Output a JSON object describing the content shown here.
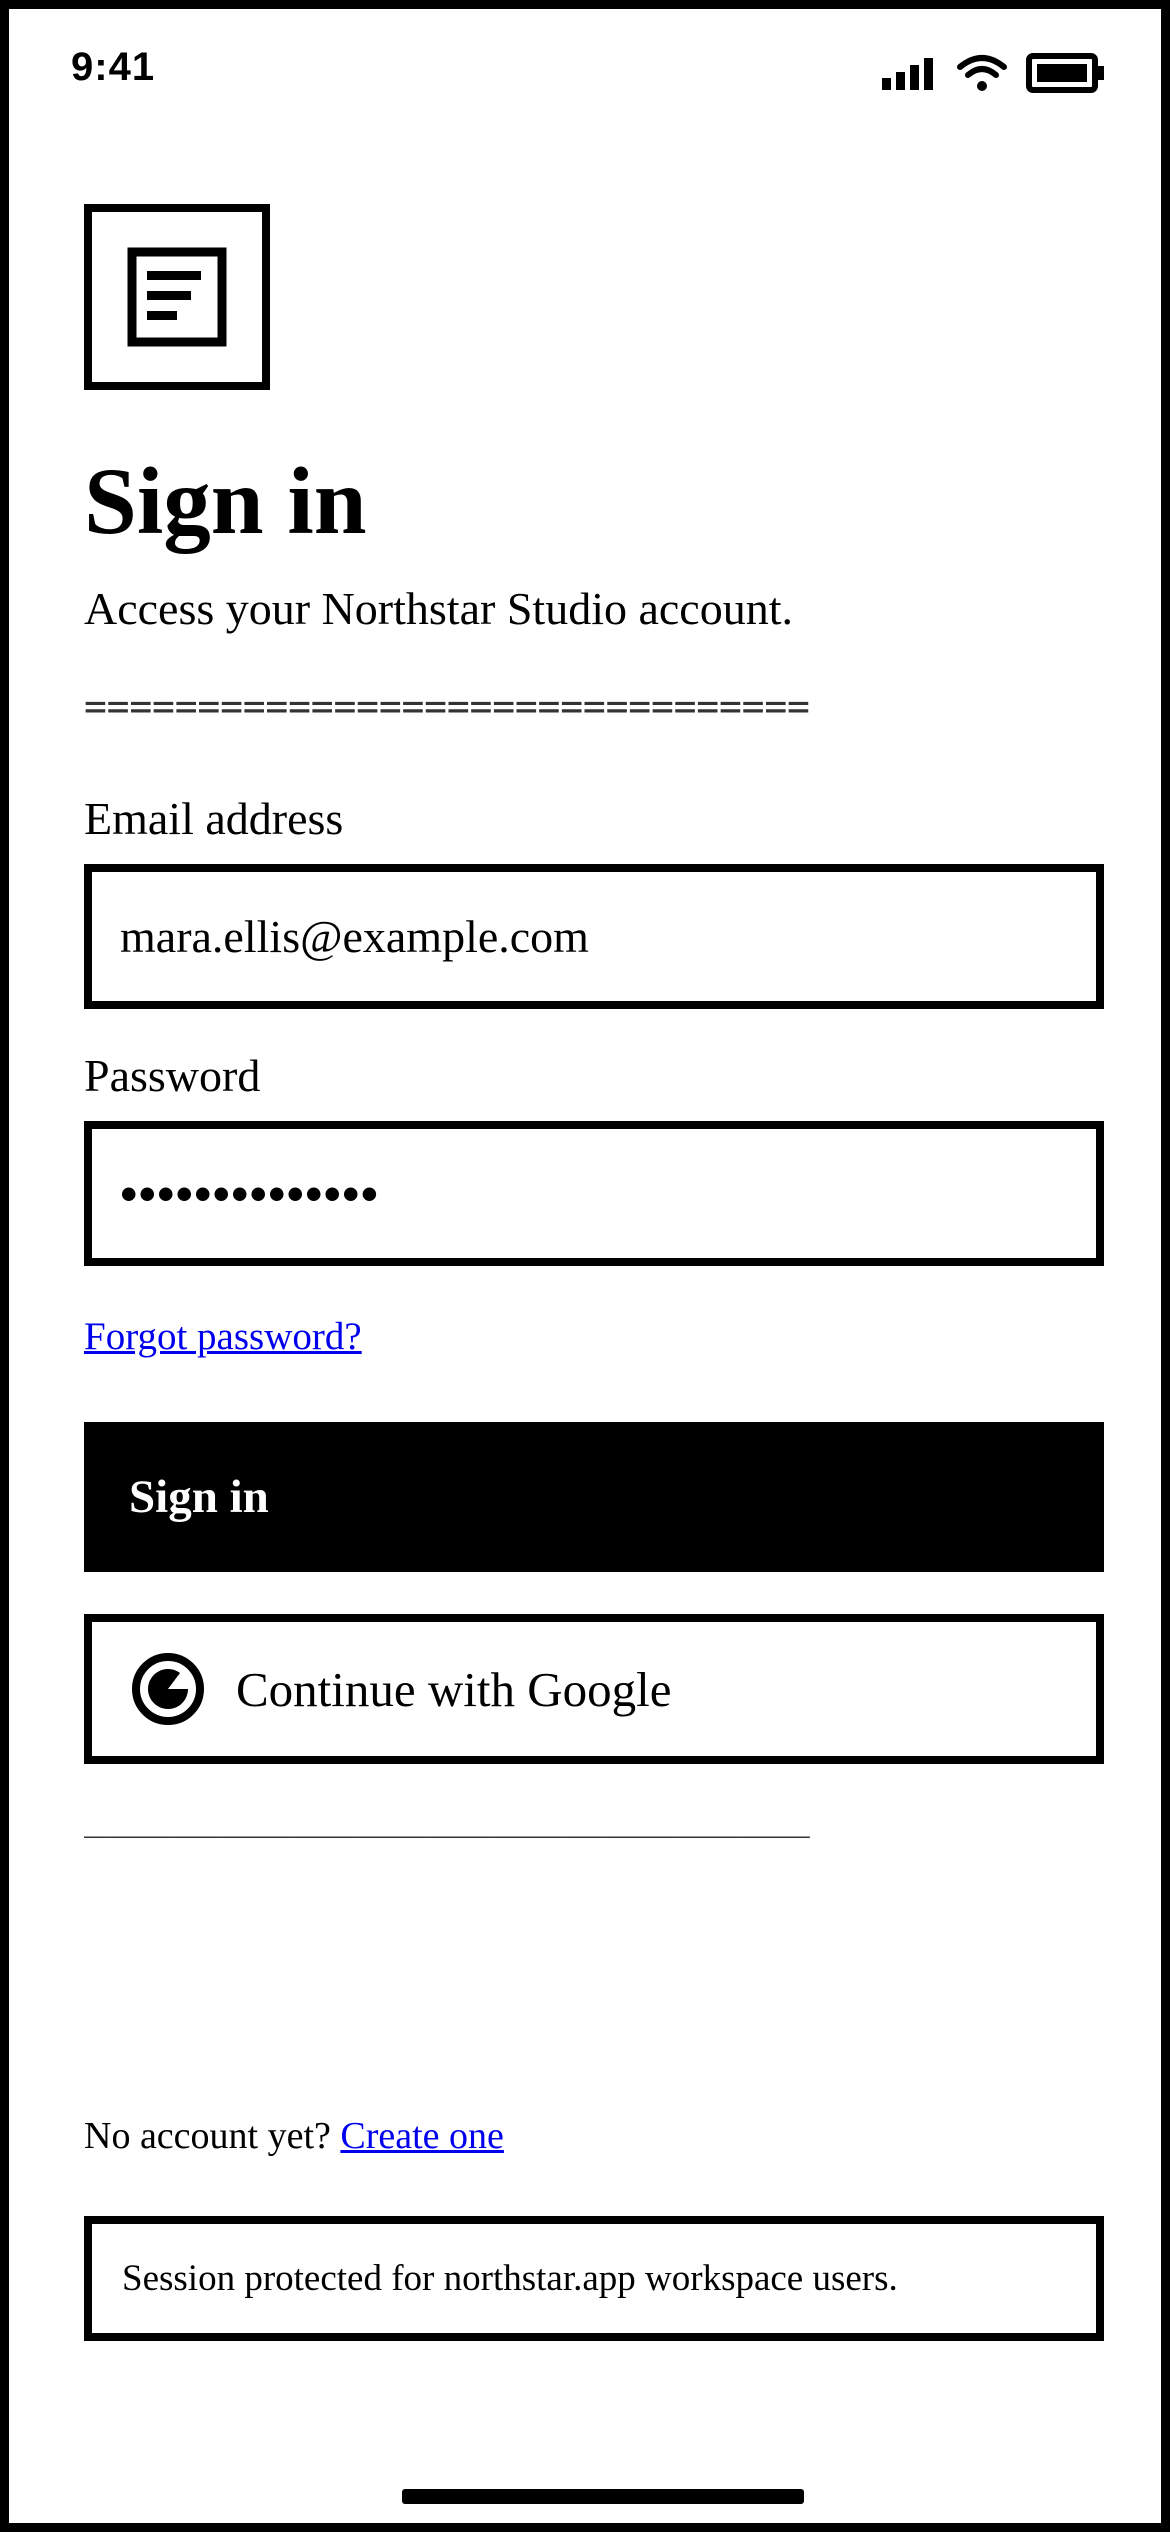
{
  "status_bar": {
    "time": "9:41",
    "icons": [
      "signal-icon",
      "wifi-icon",
      "battery-icon"
    ]
  },
  "logo": {
    "icon": "document-icon"
  },
  "title": "Sign in",
  "subtitle": "Access your Northstar Studio account.",
  "divider_top": "================================",
  "email": {
    "label": "Email address",
    "value": "mara.ellis@example.com"
  },
  "password": {
    "label": "Password",
    "value": "••••••••••••••"
  },
  "forgot_link": "Forgot password?",
  "signin_button": "Sign in",
  "google_button": {
    "label": "Continue with Google",
    "icon": "google-icon"
  },
  "divider_bottom": "________________________________",
  "signup": {
    "prompt": "No account yet? ",
    "link": "Create one"
  },
  "session_note": "Session protected for northstar.app workspace users."
}
